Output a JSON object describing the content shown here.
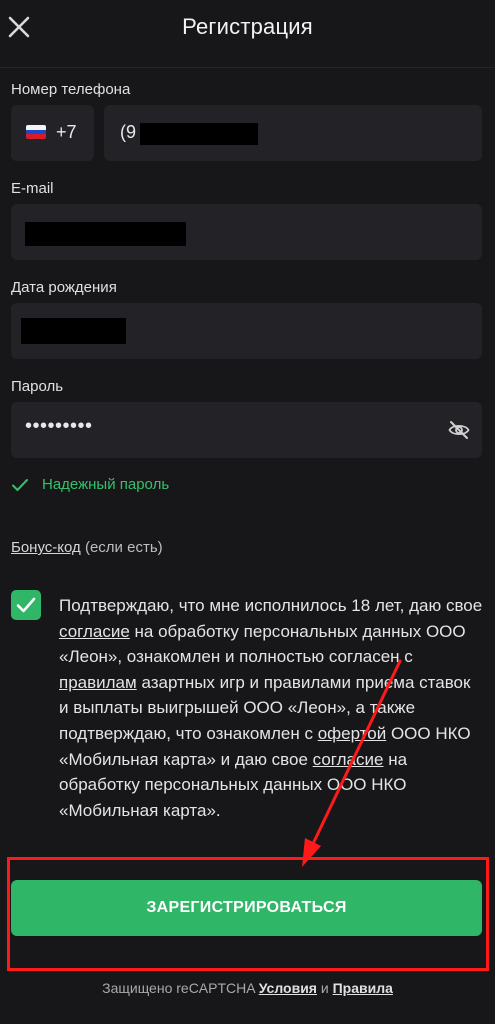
{
  "header": {
    "title": "Регистрация",
    "close_icon": "close-icon"
  },
  "phone": {
    "label": "Номер телефона",
    "country_code": "+7",
    "value_visible": "(9"
  },
  "email": {
    "label": "E-mail"
  },
  "birthdate": {
    "label": "Дата рождения"
  },
  "password": {
    "label": "Пароль",
    "value_masked": "•••••••••",
    "toggle_icon": "eye-off-icon",
    "strength_text": "Надежный пароль"
  },
  "bonus": {
    "link": "Бонус-код",
    "suffix": "(если есть)"
  },
  "consent": {
    "checked": true,
    "p1": "Подтверждаю, что мне исполнилось 18 лет, даю свое ",
    "link1": "согласие",
    "p2": " на обработку персональных данных ООО «Леон», ознакомлен и полностью согласен с ",
    "link2": "правилам",
    "p3": " азартных игр и правилами приема ставок и выплаты выигрышей ООО «Леон», а также подтверждаю, что ознакомлен с ",
    "link3": "офертой",
    "p4": " ООО НКО «Мобильная карта» и даю свое ",
    "link4": "согласие",
    "p5": " на обработку персональных данных ООО НКО «Мобильная карта»."
  },
  "register_button": "ЗАРЕГИСТРИРОВАТЬСЯ",
  "footer": {
    "prefix": "Защищено reCAPTCHA ",
    "terms": "Условия",
    "and": " и ",
    "rules": "Правила"
  },
  "colors": {
    "background": "#17171a",
    "field": "#232327",
    "accent_green": "#2fb667",
    "success_text": "#33c26a",
    "annotation_red": "#ff1a1a"
  }
}
